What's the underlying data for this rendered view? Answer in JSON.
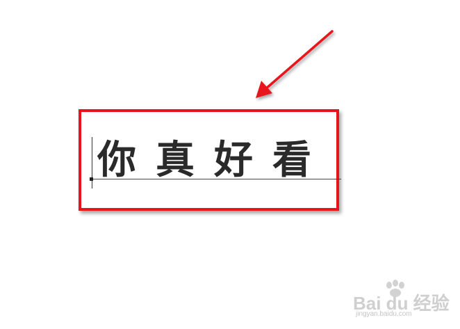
{
  "artwork": {
    "text": "你真好看",
    "text_color": "#2a2a2a"
  },
  "annotation": {
    "highlight_color": "#e8141b",
    "arrow_color": "#e8141b"
  },
  "watermark": {
    "brand": "Bai du 经验",
    "url": "jingyan.baidu.com",
    "logo_icon": "paw-icon"
  }
}
